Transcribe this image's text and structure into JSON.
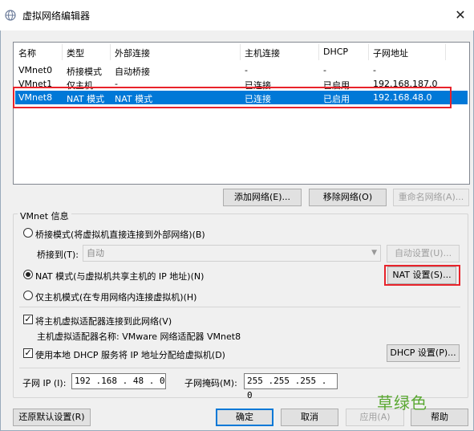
{
  "window": {
    "title": "虚拟网络编辑器",
    "close_glyph": "✕"
  },
  "table": {
    "headers": [
      "名称",
      "类型",
      "外部连接",
      "主机连接",
      "DHCP",
      "子网地址"
    ],
    "rows": [
      [
        "VMnet0",
        "桥接模式",
        "自动桥接",
        "-",
        "-",
        "-"
      ],
      [
        "VMnet1",
        "仅主机...",
        "-",
        "已连接",
        "已启用",
        "192.168.187.0"
      ],
      [
        "VMnet8",
        "NAT 模式",
        "NAT 模式",
        "已连接",
        "已启用",
        "192.168.48.0"
      ]
    ],
    "selected_row": 2
  },
  "table_buttons": {
    "add": "添加网络(E)...",
    "remove": "移除网络(O)",
    "rename": "重命名网络(A)..."
  },
  "vmnet_info": {
    "group_label": "VMnet 信息",
    "bridge_mode": "桥接模式(将虚拟机直接连接到外部网络)(B)",
    "bridge_to_label": "桥接到(T):",
    "bridge_to_value": "自动",
    "auto_settings": "自动设置(U)...",
    "nat_mode": "NAT 模式(与虚拟机共享主机的 IP 地址)(N)",
    "nat_settings": "NAT 设置(S)...",
    "host_only": "仅主机模式(在专用网络内连接虚拟机)(H)",
    "connect_adapter": "将主机虚拟适配器连接到此网络(V)",
    "adapter_name": "主机虚拟适配器名称: VMware 网络适配器 VMnet8",
    "use_dhcp": "使用本地 DHCP 服务将 IP 地址分配给虚拟机(D)",
    "dhcp_settings": "DHCP 设置(P)...",
    "subnet_ip_label": "子网 IP (I):",
    "subnet_ip_value": "192 .168 . 48 . 0",
    "subnet_mask_label": "子网掩码(M):",
    "subnet_mask_value": "255 .255 .255 . 0"
  },
  "footer": {
    "restore": "还原默认设置(R)",
    "ok": "确定",
    "cancel": "取消",
    "apply": "应用(A)",
    "help": "帮助"
  },
  "watermark": "草绿色"
}
